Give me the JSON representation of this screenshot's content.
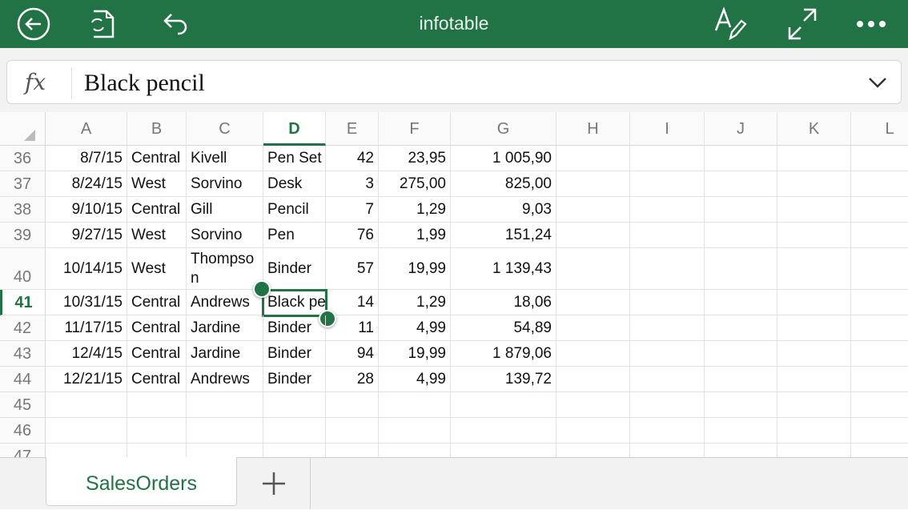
{
  "header": {
    "title": "infotable",
    "back_icon": "back-arrow-circle-icon",
    "sync_icon": "file-sync-icon",
    "undo_icon": "undo-icon",
    "edit_icon": "text-edit-pen-icon",
    "fullscreen_icon": "expand-icon",
    "more_icon": "more-dots-icon"
  },
  "formula_bar": {
    "fx_label": "fx",
    "value": "Black pencil"
  },
  "accent_color": "#217346",
  "columns": [
    "A",
    "B",
    "C",
    "D",
    "E",
    "F",
    "G",
    "H",
    "I",
    "J",
    "K",
    "L"
  ],
  "selected_column": "D",
  "selected_row": "41",
  "rows": [
    {
      "num": "36",
      "cells": [
        "8/7/15",
        "Central",
        "Kivell",
        "Pen Set",
        "42",
        "23,95",
        "1 005,90"
      ]
    },
    {
      "num": "37",
      "cells": [
        "8/24/15",
        "West",
        "Sorvino",
        "Desk",
        "3",
        "275,00",
        "825,00"
      ]
    },
    {
      "num": "38",
      "cells": [
        "9/10/15",
        "Central",
        "Gill",
        "Pencil",
        "7",
        "1,29",
        "9,03"
      ]
    },
    {
      "num": "39",
      "cells": [
        "9/27/15",
        "West",
        "Sorvino",
        "Pen",
        "76",
        "1,99",
        "151,24"
      ]
    },
    {
      "num": "40",
      "cells": [
        "10/14/15",
        "West",
        "Thompson",
        "Binder",
        "57",
        "19,99",
        "1 139,43"
      ]
    },
    {
      "num": "41",
      "cells": [
        "10/31/15",
        "Central",
        "Andrews",
        "Black pencil",
        "14",
        "1,29",
        "18,06"
      ]
    },
    {
      "num": "42",
      "cells": [
        "11/17/15",
        "Central",
        "Jardine",
        "Binder",
        "11",
        "4,99",
        "54,89"
      ]
    },
    {
      "num": "43",
      "cells": [
        "12/4/15",
        "Central",
        "Jardine",
        "Binder",
        "94",
        "19,99",
        "1 879,06"
      ]
    },
    {
      "num": "44",
      "cells": [
        "12/21/15",
        "Central",
        "Andrews",
        "Binder",
        "28",
        "4,99",
        "139,72"
      ]
    },
    {
      "num": "45",
      "cells": []
    },
    {
      "num": "46",
      "cells": []
    },
    {
      "num": "47",
      "cells": []
    }
  ],
  "sheets": [
    {
      "name": "SalesOrders",
      "active": true
    }
  ],
  "add_sheet_icon": "plus-icon"
}
